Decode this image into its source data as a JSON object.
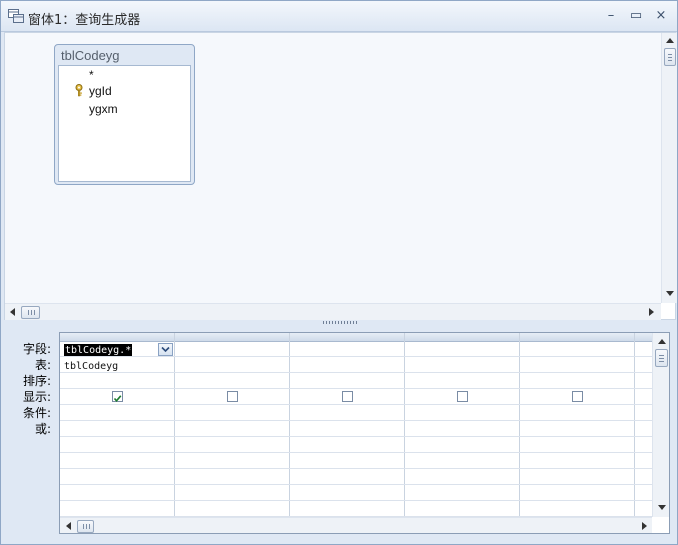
{
  "window": {
    "title": "窗体1：查询生成器",
    "controls": {
      "minimize": "–",
      "maximize": "▭",
      "close": "×"
    }
  },
  "table_box": {
    "name": "tblCodeyg",
    "fields": [
      "*",
      "ygId",
      "ygxm"
    ],
    "primary_key": "ygId"
  },
  "grid": {
    "row_labels": [
      "字段:",
      "表:",
      "排序:",
      "显示:",
      "条件:",
      "或:"
    ],
    "columns": [
      {
        "field": "tblCodeyg.*",
        "table": "tblCodeyg",
        "show": true
      },
      {
        "field": "",
        "table": "",
        "show": false
      },
      {
        "field": "",
        "table": "",
        "show": false
      },
      {
        "field": "",
        "table": "",
        "show": false
      },
      {
        "field": "",
        "table": "",
        "show": false
      }
    ]
  },
  "colors": {
    "accent": "#8fa7c6",
    "check": "#1c7a2e"
  },
  "icons": [
    "query-builder-icon",
    "key-icon",
    "checkmark-icon",
    "chevron-down-icon"
  ]
}
